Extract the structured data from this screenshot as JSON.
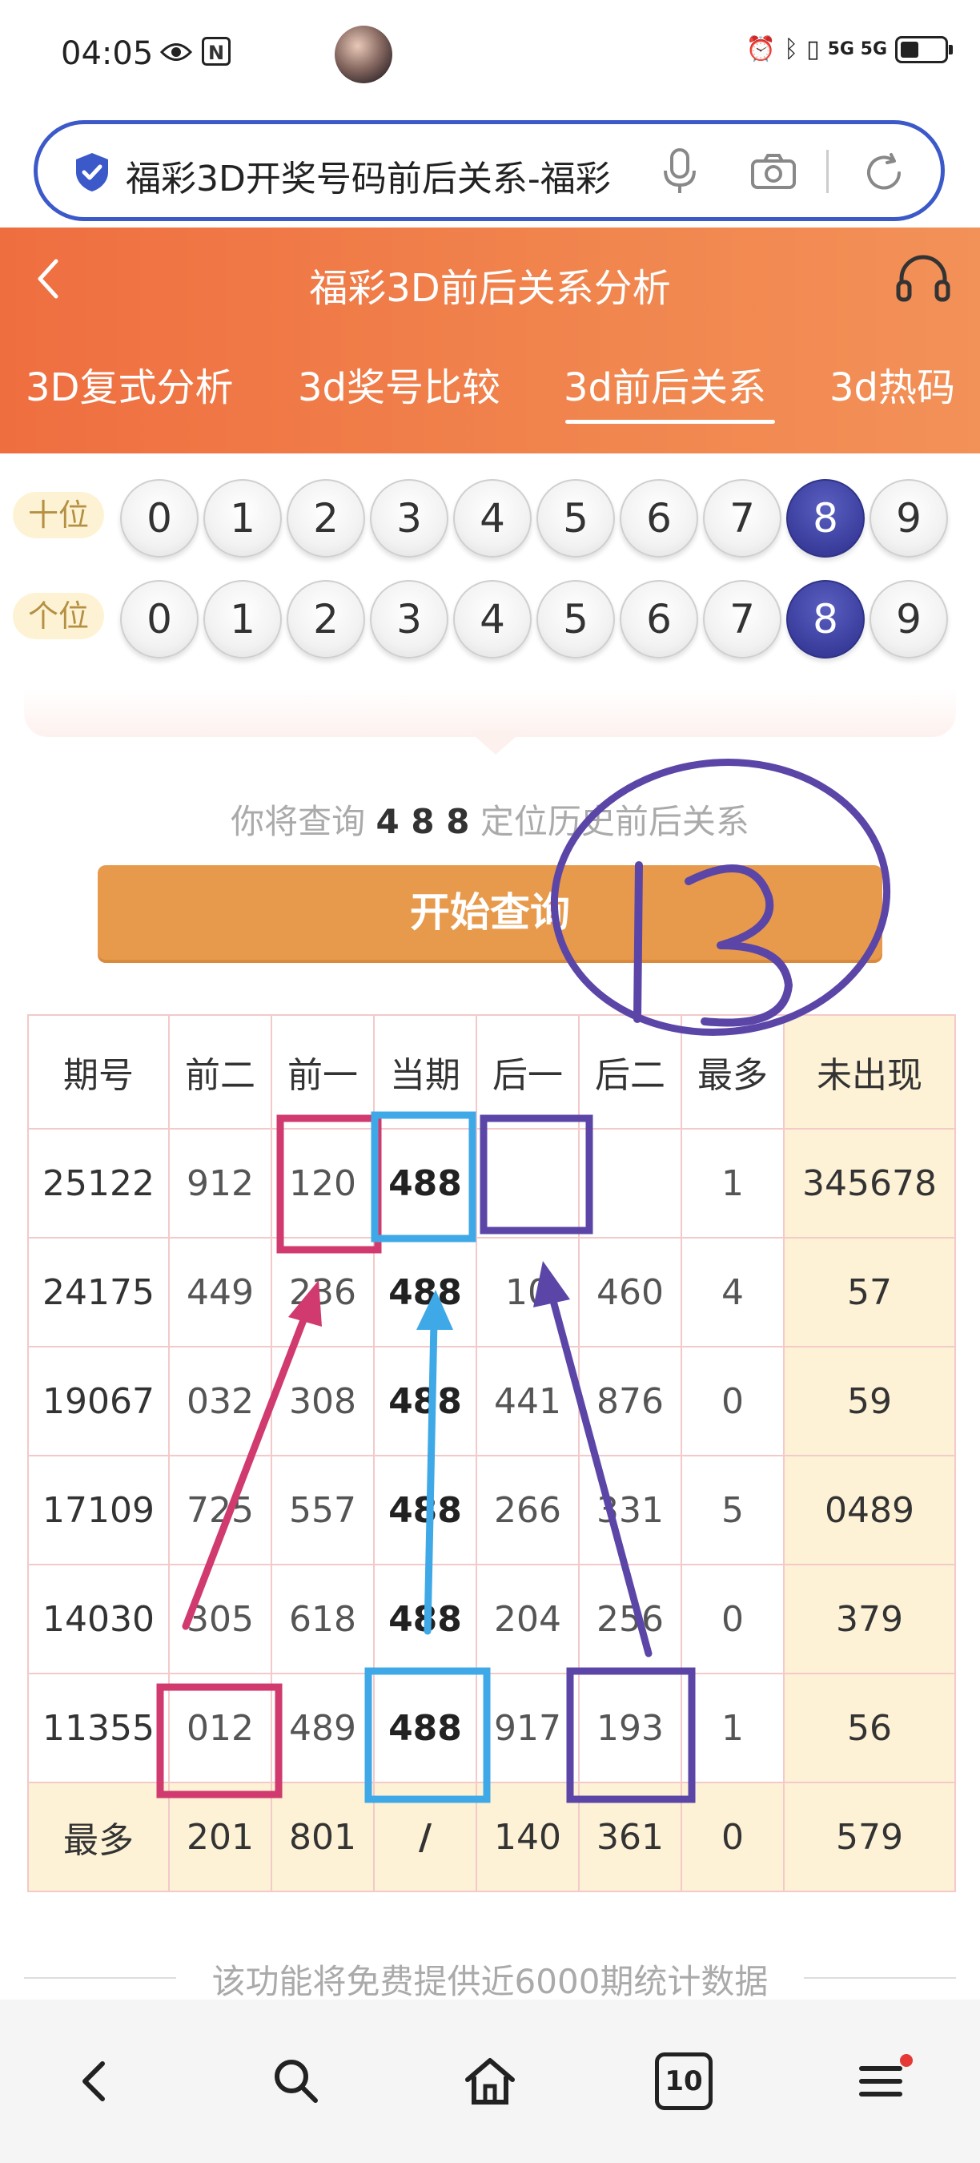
{
  "status_bar": {
    "time": "04:05",
    "nfc": "N",
    "network": "5G 5G"
  },
  "address_bar": {
    "url_title": "福彩3D开奖号码前后关系-福彩"
  },
  "header": {
    "title": "福彩3D前后关系分析",
    "tabs": [
      "3D复式分析",
      "3d奖号比较",
      "3d前后关系",
      "3d热码"
    ],
    "active_tab": "3d前后关系"
  },
  "selectors": [
    {
      "label": "十位",
      "digits": [
        "0",
        "1",
        "2",
        "3",
        "4",
        "5",
        "6",
        "7",
        "8",
        "9"
      ],
      "selected": "8"
    },
    {
      "label": "个位",
      "digits": [
        "0",
        "1",
        "2",
        "3",
        "4",
        "5",
        "6",
        "7",
        "8",
        "9"
      ],
      "selected": "8"
    }
  ],
  "query": {
    "prefix": "你将查询",
    "number": "4 8 8",
    "suffix": "定位历史前后关系",
    "button": "开始查询"
  },
  "table": {
    "headers": [
      "期号",
      "前二",
      "前一",
      "当期",
      "后一",
      "后二",
      "最多",
      "未出现"
    ],
    "rows": [
      [
        "25122",
        "912",
        "120",
        "488",
        "",
        "",
        "1",
        "345678"
      ],
      [
        "24175",
        "449",
        "236",
        "488",
        "10",
        "460",
        "4",
        "57"
      ],
      [
        "19067",
        "032",
        "308",
        "488",
        "441",
        "876",
        "0",
        "59"
      ],
      [
        "17109",
        "725",
        "557",
        "488",
        "266",
        "331",
        "5",
        "0489"
      ],
      [
        "14030",
        "305",
        "618",
        "488",
        "204",
        "256",
        "0",
        "379"
      ],
      [
        "11355",
        "012",
        "489",
        "488",
        "917",
        "193",
        "1",
        "56"
      ]
    ],
    "max_row": [
      "最多",
      "201",
      "801",
      "/",
      "140",
      "361",
      "0",
      "579"
    ]
  },
  "annotation": {
    "handwritten_number": "13"
  },
  "footer": {
    "note": "该功能将免费提供近6000期统计数据"
  },
  "nav": {
    "tabs_count": "10",
    "icons": [
      "back-icon",
      "search-icon",
      "home-icon",
      "tabs-icon",
      "menu-icon"
    ]
  },
  "colors": {
    "header_orange": "#ef6e40",
    "selected_ball": "#3a3d9c",
    "button_orange": "#e79a4c",
    "annot_pink": "#d03a6e",
    "annot_blue": "#3fa9e8",
    "annot_purple": "#5b46a8"
  }
}
